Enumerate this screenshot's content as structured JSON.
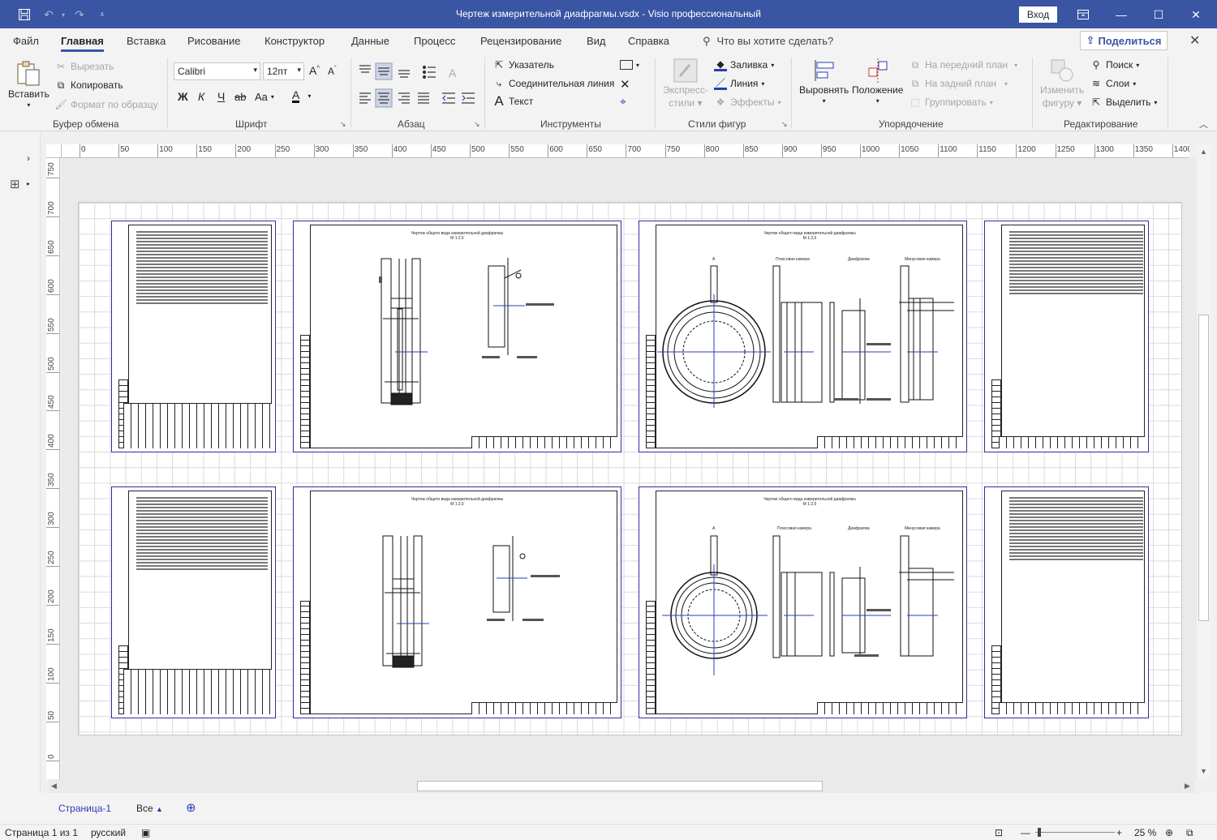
{
  "window": {
    "title": "Чертеж измерительной диафрагмы.vsdx  -  Visio профессиональный",
    "signin": "Вход"
  },
  "menu": {
    "tabs": [
      "Файл",
      "Главная",
      "Вставка",
      "Рисование",
      "Конструктор",
      "Данные",
      "Процесс",
      "Рецензирование",
      "Вид",
      "Справка"
    ],
    "active_tab": "Главная",
    "search_placeholder": "Что вы хотите сделать?",
    "share": "Поделиться"
  },
  "ribbon": {
    "clipboard": {
      "paste": "Вставить",
      "cut": "Вырезать",
      "copy": "Копировать",
      "format_painter": "Формат по образцу",
      "label": "Буфер обмена"
    },
    "font": {
      "family": "Calibri",
      "size": "12пт",
      "bold": "Ж",
      "italic": "К",
      "underline": "Ч",
      "strike": "ab",
      "case": "Aa",
      "color_glyph": "A",
      "label": "Шрифт"
    },
    "paragraph": {
      "label": "Абзац"
    },
    "tools": {
      "pointer": "Указатель",
      "connector": "Соединительная линия",
      "text": "Текст",
      "label": "Инструменты"
    },
    "shape_styles": {
      "quick_styles_line1": "Экспресс-",
      "quick_styles_line2": "стили",
      "fill": "Заливка",
      "line": "Линия",
      "effects": "Эффекты",
      "label": "Стили фигур"
    },
    "arrange": {
      "align": "Выровнять",
      "position": "Положение",
      "bring_front": "На передний план",
      "send_back": "На задний план",
      "group": "Группировать",
      "label": "Упорядочение"
    },
    "editing": {
      "change_shape_line1": "Изменить",
      "change_shape_line2": "фигуру",
      "find": "Поиск",
      "layers": "Слои",
      "select": "Выделить",
      "label": "Редактирование"
    }
  },
  "rulers": {
    "horizontal": [
      "0",
      "50",
      "100",
      "150",
      "200",
      "250",
      "300",
      "350",
      "400",
      "450",
      "500",
      "550",
      "600",
      "650",
      "700",
      "750",
      "800",
      "850",
      "900",
      "950",
      "1000",
      "1050",
      "1100",
      "1150",
      "1200",
      "1250",
      "1300",
      "1350",
      "1400"
    ],
    "vertical": [
      "750",
      "700",
      "650",
      "600",
      "550",
      "500",
      "450",
      "400",
      "350",
      "300",
      "250",
      "200",
      "150",
      "100",
      "50",
      "0"
    ]
  },
  "drawing": {
    "sheet_title": "Чертеж общего вида измерительной диафрагмы",
    "scale_a": "М 1:2,5",
    "scale_b": "М 1:2,5",
    "plus_chamber": "Плюсовая камера",
    "diaphragm": "Диафрагма",
    "minus_chamber": "Минусовая камера",
    "view_a": "А"
  },
  "pages": {
    "current": "Страница-1",
    "all": "Все"
  },
  "status": {
    "page_info": "Страница 1 из 1",
    "language": "русский",
    "zoom": "25 %"
  },
  "colors": {
    "titlebar": "#3955a3",
    "sheet_border": "#2f2fa0",
    "accent_blue": "#2a3cb8"
  }
}
